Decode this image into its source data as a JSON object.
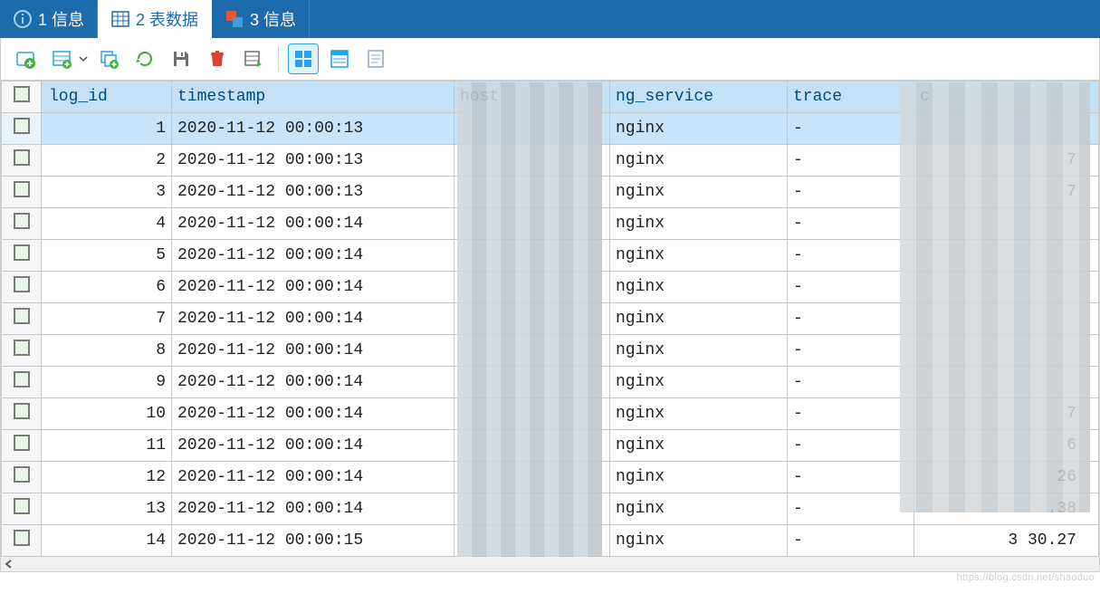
{
  "tabs": [
    {
      "label": "1 信息",
      "icon": "info"
    },
    {
      "label": "2 表数据",
      "icon": "grid",
      "active": true
    },
    {
      "label": "3 信息",
      "icon": "square"
    }
  ],
  "columns": {
    "chk": "",
    "log_id": "log_id",
    "timestamp": "timestamp",
    "host": "host",
    "ng_service": "ng_service",
    "trace": "trace",
    "c_last": "c"
  },
  "rows": [
    {
      "id": "1",
      "ts": "2020-11-12 00:00:13",
      "svc": "nginx",
      "trace": "-",
      "last": "",
      "sel": true
    },
    {
      "id": "2",
      "ts": "2020-11-12 00:00:13",
      "svc": "nginx",
      "trace": "-",
      "last": "7"
    },
    {
      "id": "3",
      "ts": "2020-11-12 00:00:13",
      "svc": "nginx",
      "trace": "-",
      "last": "7"
    },
    {
      "id": "4",
      "ts": "2020-11-12 00:00:14",
      "svc": "nginx",
      "trace": "-",
      "last": ""
    },
    {
      "id": "5",
      "ts": "2020-11-12 00:00:14",
      "svc": "nginx",
      "trace": "-",
      "last": ""
    },
    {
      "id": "6",
      "ts": "2020-11-12 00:00:14",
      "svc": "nginx",
      "trace": "-",
      "last": ""
    },
    {
      "id": "7",
      "ts": "2020-11-12 00:00:14",
      "svc": "nginx",
      "trace": "-",
      "last": ""
    },
    {
      "id": "8",
      "ts": "2020-11-12 00:00:14",
      "svc": "nginx",
      "trace": "-",
      "last": ""
    },
    {
      "id": "9",
      "ts": "2020-11-12 00:00:14",
      "svc": "nginx",
      "trace": "-",
      "last": ""
    },
    {
      "id": "10",
      "ts": "2020-11-12 00:00:14",
      "svc": "nginx",
      "trace": "-",
      "last": "7"
    },
    {
      "id": "11",
      "ts": "2020-11-12 00:00:14",
      "svc": "nginx",
      "trace": "-",
      "last": "6"
    },
    {
      "id": "12",
      "ts": "2020-11-12 00:00:14",
      "svc": "nginx",
      "trace": "-",
      "last": "26"
    },
    {
      "id": "13",
      "ts": "2020-11-12 00:00:14",
      "svc": "nginx",
      "trace": "-",
      "last": ".38"
    },
    {
      "id": "14",
      "ts": "2020-11-12 00:00:15",
      "svc": "nginx",
      "trace": "-",
      "last": "3 30.27"
    }
  ],
  "watermark": "https://blog.csdn.net/shaoduo"
}
